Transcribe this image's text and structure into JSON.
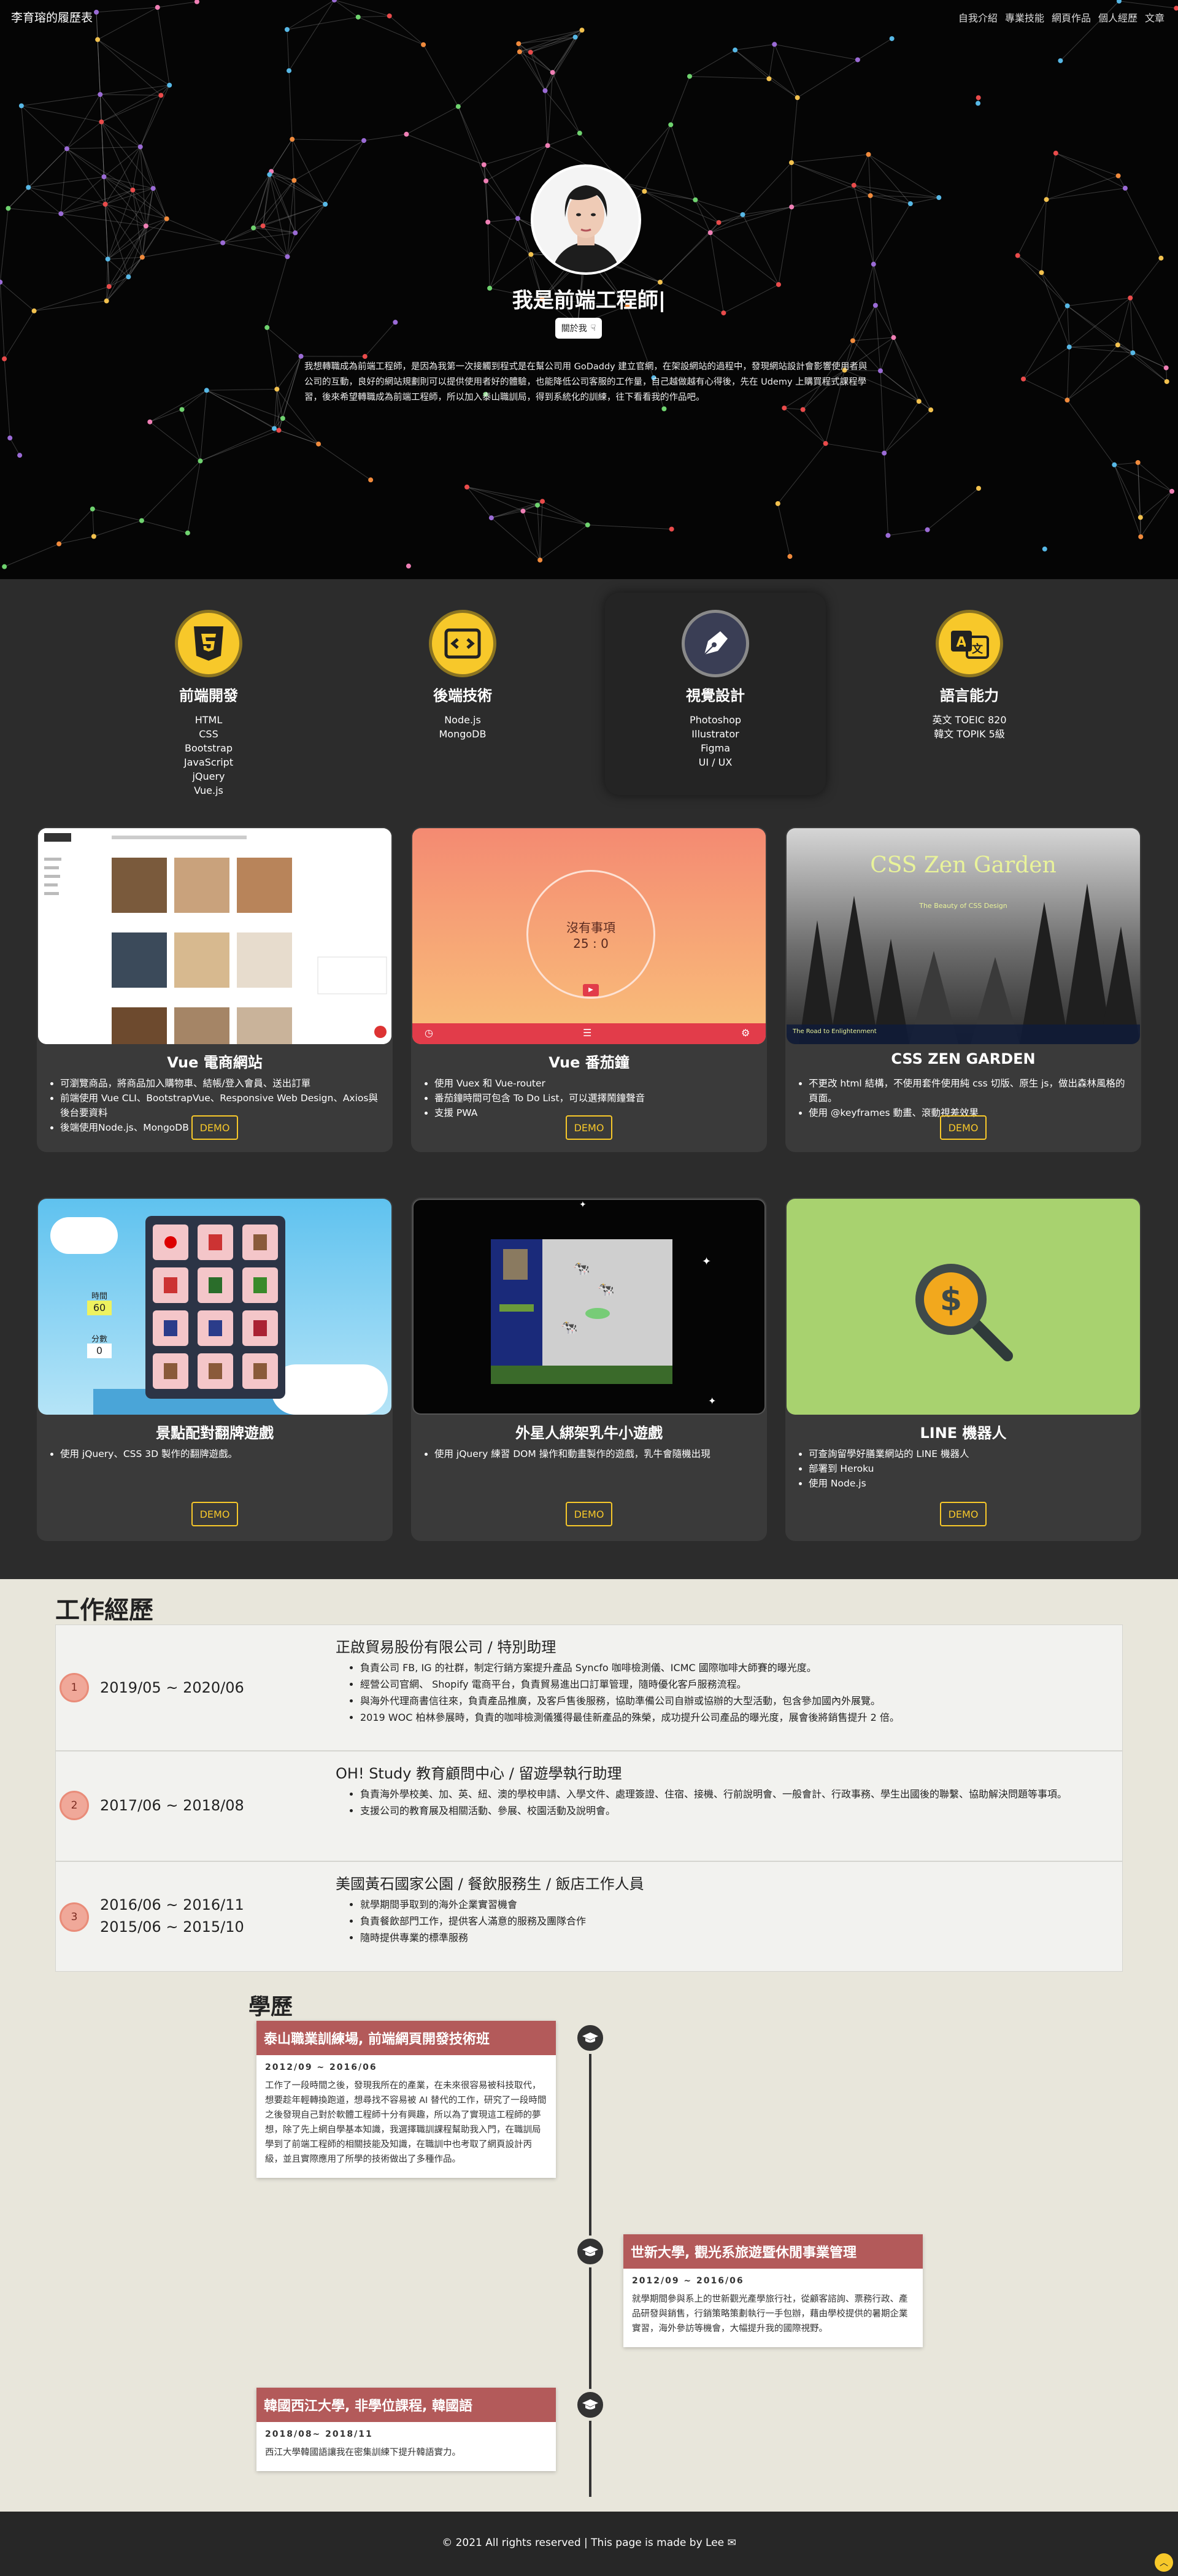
{
  "nav": {
    "brand": "李育瑢的履歷表",
    "links": [
      "自我介紹",
      "專業技能",
      "網頁作品",
      "個人經歷",
      "文章"
    ]
  },
  "hero": {
    "title": "我是前端工程師|",
    "about_button": "關於我",
    "intro": "我想轉職成為前端工程師，是因為我第一次接觸到程式是在幫公司用 GoDaddy 建立官網，在架設網站的過程中，發現網站設計會影響使用者與公司的互動，良好的網站規劃則可以提供使用者好的體驗，也能降低公司客服的工作量，自己越做越有心得後，先在 Udemy 上購買程式課程學習，後來希望轉職成為前端工程師，所以加入泰山職訓局，得到系統化的訓練，往下看看我的作品吧。"
  },
  "skills": [
    {
      "title": "前端開發",
      "icon": "css3-icon",
      "items": [
        "HTML",
        "CSS",
        "Bootstrap",
        "JavaScript",
        "jQuery",
        "Vue.js"
      ]
    },
    {
      "title": "後端技術",
      "icon": "code-window-icon",
      "items": [
        "Node.js",
        "MongoDB"
      ]
    },
    {
      "title": "視覺設計",
      "icon": "pen-nib-icon",
      "items": [
        "Photoshop",
        "Illustrator",
        "Figma",
        "UI / UX"
      ]
    },
    {
      "title": "語言能力",
      "icon": "translate-icon",
      "items": [
        "英文 TOEIC 820",
        "韓文 TOPIK 5級"
      ]
    }
  ],
  "projects": [
    {
      "title": "Vue 電商網站",
      "demo": "DEMO",
      "bullets": [
        "可瀏覽商品，將商品加入購物車、結帳/登入會員、送出訂單",
        "前端使用 Vue CLI、BootstrapVue、Responsive Web Design、Axios與後台要資料",
        "後端使用Node.js、MongoDB"
      ]
    },
    {
      "title": "Vue 番茄鐘",
      "demo": "DEMO",
      "timer_label": "沒有事項",
      "timer_value": "25 : 0",
      "bullets": [
        "使用 Vuex 和 Vue-router",
        "番茄鐘時間可包含 To Do List，可以選擇鬧鐘聲音",
        "支援 PWA"
      ]
    },
    {
      "title": "CSS ZEN GARDEN",
      "demo": "DEMO",
      "shot_title": "CSS Zen Garden",
      "shot_subtitle": "The Beauty of CSS Design",
      "shot_footer": "The Road to Enlightenment",
      "bullets": [
        "不更改 html 結構，不使用套件使用純 css 切版、原生 js，做出森林風格的頁面。",
        "使用 @keyframes 動畫、滾動視差效果"
      ]
    },
    {
      "title": "景點配對翻牌遊戲",
      "demo": "DEMO",
      "game_time_label": "時間",
      "game_time_value": "60",
      "game_score_label": "分數",
      "game_score_value": "0",
      "bullets": [
        "使用 jQuery、CSS 3D 製作的翻牌遊戲。"
      ]
    },
    {
      "title": "外星人綁架乳牛小遊戲",
      "demo": "DEMO",
      "bullets": [
        "使用 jQuery 練習 DOM 操作和動畫製作的遊戲，乳牛會隨機出現"
      ]
    },
    {
      "title": "LINE 機器人",
      "demo": "DEMO",
      "bullets": [
        "可查詢留學好膳業網站的 LINE 機器人",
        "部署到 Heroku",
        "使用 Node.js"
      ]
    }
  ],
  "work": {
    "title": "工作經歷",
    "jobs": [
      {
        "num": "1",
        "dates": [
          "2019/05 ~ 2020/06"
        ],
        "title": "正啟貿易股份有限公司 / 特別助理",
        "bullets": [
          "負責公司 FB, IG 的社群，制定行銷方案提升產品 Syncfo 咖啡檢測儀、ICMC 國際咖啡大師賽的曝光度。",
          "經營公司官網、 Shopify 電商平台，負責貿易進出口訂單管理，隨時優化客戶服務流程。",
          "與海外代理商書信往來，負責產品推廣，及客戶售後服務，協助準備公司自辦或協辦的大型活動，包含參加國內外展覽。",
          "2019 WOC 柏林參展時，負責的咖啡檢測儀獲得最佳新產品的殊榮，成功提升公司產品的曝光度，展會後將銷售提升 2 倍。"
        ]
      },
      {
        "num": "2",
        "dates": [
          "2017/06 ~ 2018/08"
        ],
        "title": "OH! Study 教育顧問中心 / 留遊學執行助理",
        "bullets": [
          "負責海外學校美、加、英、紐、澳的學校申請、入學文件、處理簽證、住宿、接機、行前說明會、一般會計、行政事務、學生出國後的聯繫、協助解決問題等事項。",
          "支援公司的教育展及相關活動、參展、校園活動及說明會。"
        ]
      },
      {
        "num": "3",
        "dates": [
          "2016/06 ~ 2016/11",
          "2015/06 ~ 2015/10"
        ],
        "title": "美國黃石國家公園 / 餐飲服務生 / 飯店工作人員",
        "bullets": [
          "就學期間爭取到的海外企業實習機會",
          "負責餐飲部門工作，提供客人滿意的服務及團隊合作",
          "隨時提供專業的標準服務"
        ]
      }
    ]
  },
  "education": {
    "title": "學歷",
    "items": [
      {
        "school": "泰山職業訓練場, 前端網頁開發技術班",
        "dates": "2012/09 ~ 2016/06",
        "desc": "工作了一段時間之後，發現我所在的產業，在未來很容易被科技取代，想要趁年輕轉換跑道，想尋找不容易被 AI 替代的工作，研究了一段時間之後發現自己對於軟體工程師十分有興趣，所以為了實現這工程師的夢想，除了先上網自學基本知識，我選擇職訓課程幫助我入門，在職訓局學到了前端工程師的相關技能及知識，在職訓中也考取了網頁設計丙級，並且實際應用了所學的技術做出了多種作品。"
      },
      {
        "school": "世新大學, 觀光系旅遊暨休閒事業管理",
        "dates": "2012/09 ~ 2016/06",
        "desc": "就學期間參與系上的世新觀光產學旅行社，從顧客諮詢、票務行政、產品研發與銷售，行銷策略策劃執行一手包辦，藉由學校提供的暑期企業實習，海外參訪等機會，大幅提升我的國際視野。"
      },
      {
        "school": "韓國西江大學, 非學位課程, 韓國語",
        "dates": "2018/08~ 2018/11",
        "desc": "西江大學韓國語讓我在密集訓練下提升韓語實力。"
      }
    ]
  },
  "footer": {
    "text": "© 2021 All rights reserved | This page is made by Lee ✉"
  },
  "colors": {
    "accent": "#f7c82a",
    "dark": "#2c2c2c",
    "edu_header": "#b35a5a",
    "job_num": "#f0a899"
  }
}
